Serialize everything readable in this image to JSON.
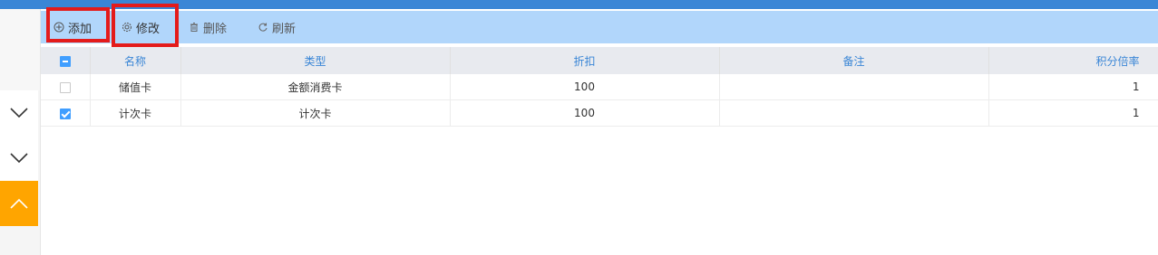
{
  "colors": {
    "topbar": "#3a86d6",
    "toolbar_bg": "#b1d6fb",
    "header_bg": "#e8eaef",
    "header_text": "#3a86d6",
    "highlight": "#e41b1b",
    "active_nav": "#ffa500"
  },
  "toolbar": {
    "add_label": "添加",
    "edit_label": "修改",
    "delete_label": "删除",
    "refresh_label": "刷新",
    "icons": {
      "add": "plus-circle-icon",
      "edit": "gear-icon",
      "delete": "trash-icon",
      "refresh": "refresh-icon"
    }
  },
  "table": {
    "columns": [
      "名称",
      "类型",
      "折扣",
      "备注",
      "积分倍率"
    ],
    "header_select_state": "partial",
    "rows": [
      {
        "checked": false,
        "name": "储值卡",
        "type": "金额消费卡",
        "discount": "100",
        "note": "",
        "ratio": "1"
      },
      {
        "checked": true,
        "name": "计次卡",
        "type": "计次卡",
        "discount": "100",
        "note": "",
        "ratio": "1"
      }
    ]
  },
  "nav": {
    "icons": [
      "chevron-down-icon",
      "chevron-down-icon",
      "chevron-up-icon"
    ]
  }
}
